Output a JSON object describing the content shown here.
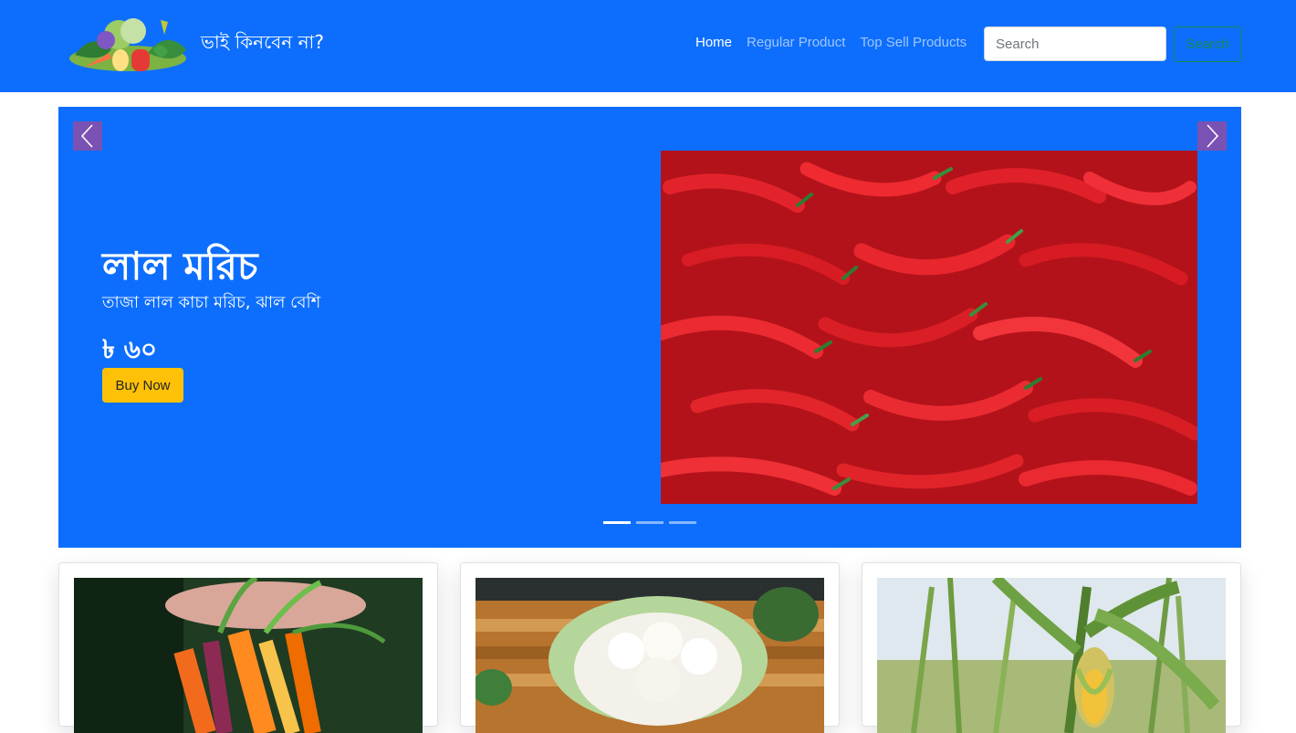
{
  "brand": {
    "title": "ভাই কিনবেন না?",
    "logo_icon": "vegetable-basket-logo"
  },
  "nav": {
    "items": [
      {
        "label": "Home",
        "active": true
      },
      {
        "label": "Regular Product",
        "active": false
      },
      {
        "label": "Top Sell Products",
        "active": false
      }
    ]
  },
  "search": {
    "placeholder": "Search",
    "button_label": "Search"
  },
  "carousel": {
    "slide": {
      "title": "লাল মরিচ",
      "description": "তাজা লাল কাচা মরিচ, ঝাল বেশি",
      "price": "৳ ৬০",
      "button_label": "Buy Now",
      "image_icon": "red-chili-photo"
    },
    "indicators": [
      true,
      false,
      false
    ],
    "prev_icon": "chevron-left-icon",
    "next_icon": "chevron-right-icon"
  },
  "products": [
    {
      "image_icon": "carrots-photo"
    },
    {
      "image_icon": "cauliflower-photo"
    },
    {
      "image_icon": "corn-photo"
    }
  ],
  "colors": {
    "primary": "#0d6efd",
    "warning": "#ffc107",
    "success": "#198754",
    "control": "#7952b3"
  }
}
